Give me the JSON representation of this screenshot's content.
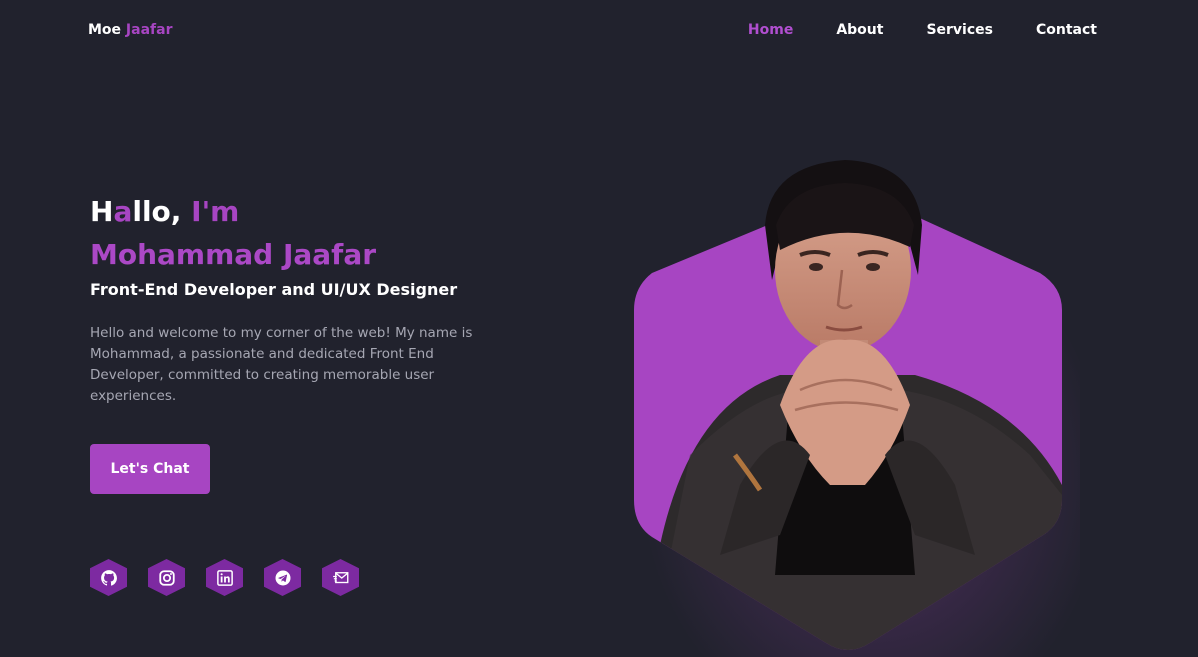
{
  "header": {
    "logo_first": "Moe",
    "logo_accent": "Jaafar",
    "nav": [
      "Home",
      "About",
      "Services",
      "Contact"
    ],
    "active_nav": "Home"
  },
  "hero": {
    "greet_h": "H",
    "greet_a": "a",
    "greet_rest": "llo,",
    "greet_im": "I'm",
    "name": "Mohammad Jaafar",
    "role": "Front-End Developer and UI/UX Designer",
    "intro": "Hello and welcome to my corner of the web! My name is Mohammad, a passionate and dedicated Front End Developer, committed to creating memorable user experiences.",
    "cta_label": "Let's Chat"
  },
  "socials": [
    {
      "icon": "github-icon"
    },
    {
      "icon": "instagram-icon"
    },
    {
      "icon": "linkedin-icon"
    },
    {
      "icon": "telegram-icon"
    },
    {
      "icon": "mail-icon"
    }
  ],
  "colors": {
    "background": "#21222d",
    "accent": "#a745c2",
    "hex_button": "#7d2aa1",
    "muted_text": "#a6a7b3"
  }
}
